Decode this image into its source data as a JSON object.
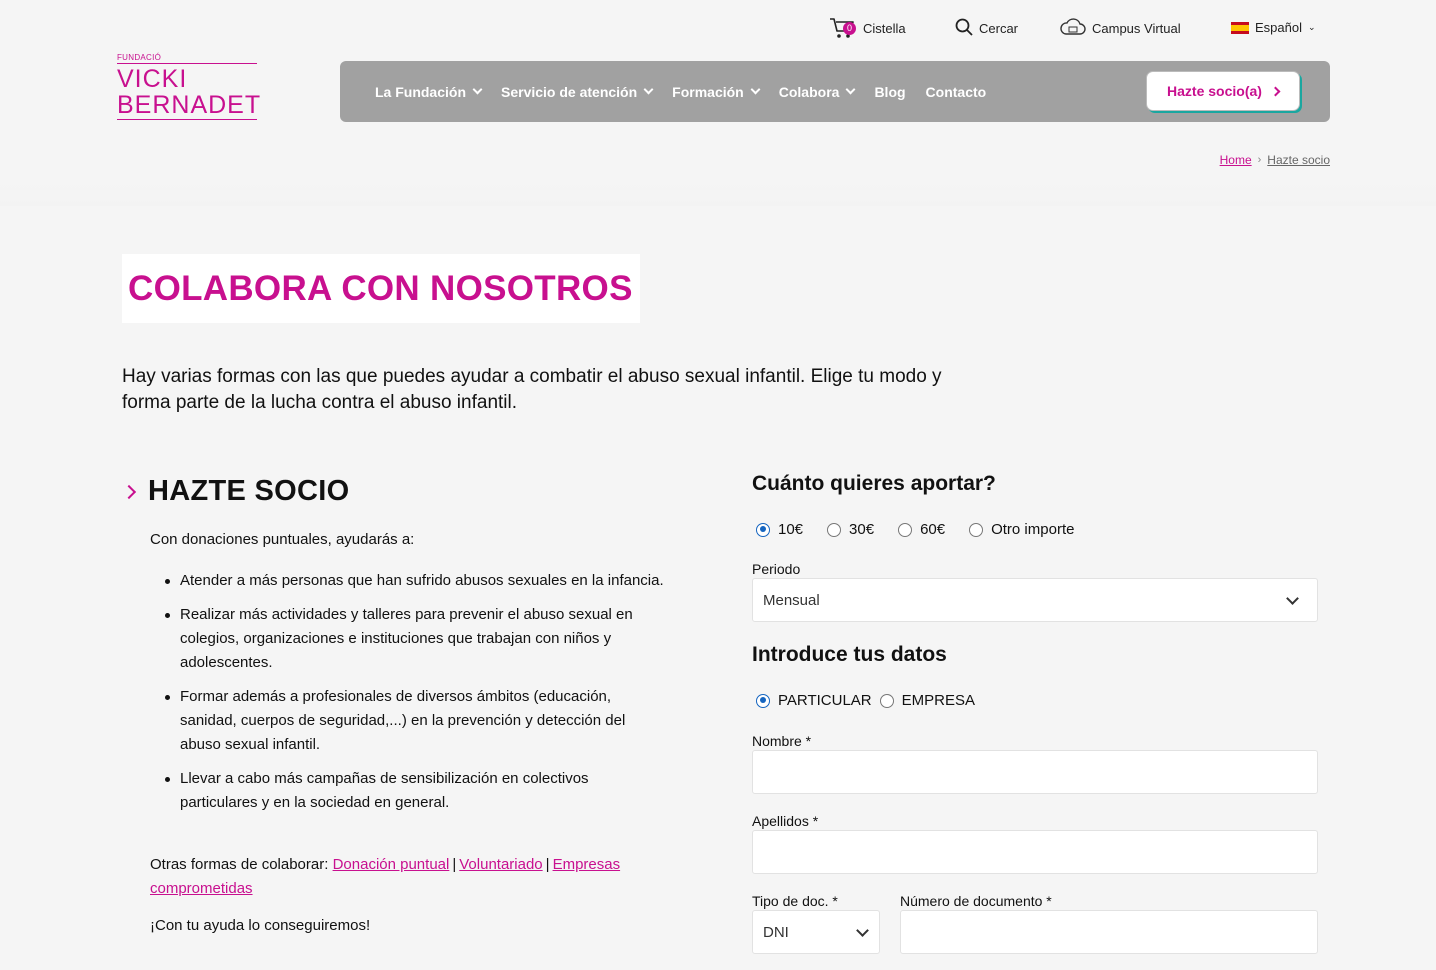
{
  "topbar": {
    "cart_label": "Cistella",
    "cart_count": "0",
    "search_label": "Cercar",
    "campus_label": "Campus Virtual",
    "language_label": "Español"
  },
  "logo": {
    "small": "FUNDACIÓ",
    "line1": "VICKI",
    "line2": "BERNADET"
  },
  "nav": {
    "items": [
      {
        "label": "La Fundación",
        "dropdown": true
      },
      {
        "label": "Servicio de atención",
        "dropdown": true
      },
      {
        "label": "Formación",
        "dropdown": true
      },
      {
        "label": "Colabora",
        "dropdown": true
      },
      {
        "label": "Blog",
        "dropdown": false
      },
      {
        "label": "Contacto",
        "dropdown": false
      }
    ],
    "cta": "Hazte socio(a)"
  },
  "breadcrumb": {
    "home": "Home",
    "current": "Hazte socio"
  },
  "page_title": "COLABORA CON NOSOTROS",
  "intro": "Hay varias formas con las que puedes ayudar a combatir el abuso sexual infantil. Elige tu modo y forma parte de la lucha contra el abuso infantil.",
  "section": {
    "title": "HAZTE SOCIO",
    "lead": "Con donaciones puntuales, ayudarás a:",
    "bullets": [
      "Atender a más personas que han sufrido abusos sexuales en la infancia.",
      "Realizar más actividades y talleres para prevenir el abuso sexual en colegios, organizaciones e instituciones que trabajan con niños y adolescentes.",
      "Formar además a profesionales de diversos ámbitos (educación, sanidad, cuerpos de seguridad,...) en la prevención y detección del abuso sexual infantil.",
      "Llevar a cabo más campañas de sensibilización en colectivos particulares y en la sociedad en general."
    ],
    "other_prefix": "Otras formas de colaborar:",
    "other_links": [
      "Donación puntual",
      "Voluntariado",
      "Empresas comprometidas"
    ],
    "thanks": "¡Con tu ayuda lo conseguiremos!"
  },
  "form": {
    "amount_title": "Cuánto quieres aportar?",
    "amounts": [
      "10€",
      "30€",
      "60€",
      "Otro importe"
    ],
    "amount_selected": "10€",
    "period_label": "Periodo",
    "period_value": "Mensual",
    "data_title": "Introduce tus datos",
    "person_types": [
      "PARTICULAR",
      "EMPRESA"
    ],
    "person_selected": "PARTICULAR",
    "name_label": "Nombre *",
    "name_value": "",
    "surname_label": "Apellidos *",
    "surname_value": "",
    "doc_type_label": "Tipo de doc. *",
    "doc_type_value": "DNI",
    "doc_number_label": "Número de documento *",
    "doc_number_value": ""
  },
  "colors": {
    "accent": "#c8108f",
    "nav_bg": "#a1a1a1",
    "radio_selected": "#1565c0"
  }
}
